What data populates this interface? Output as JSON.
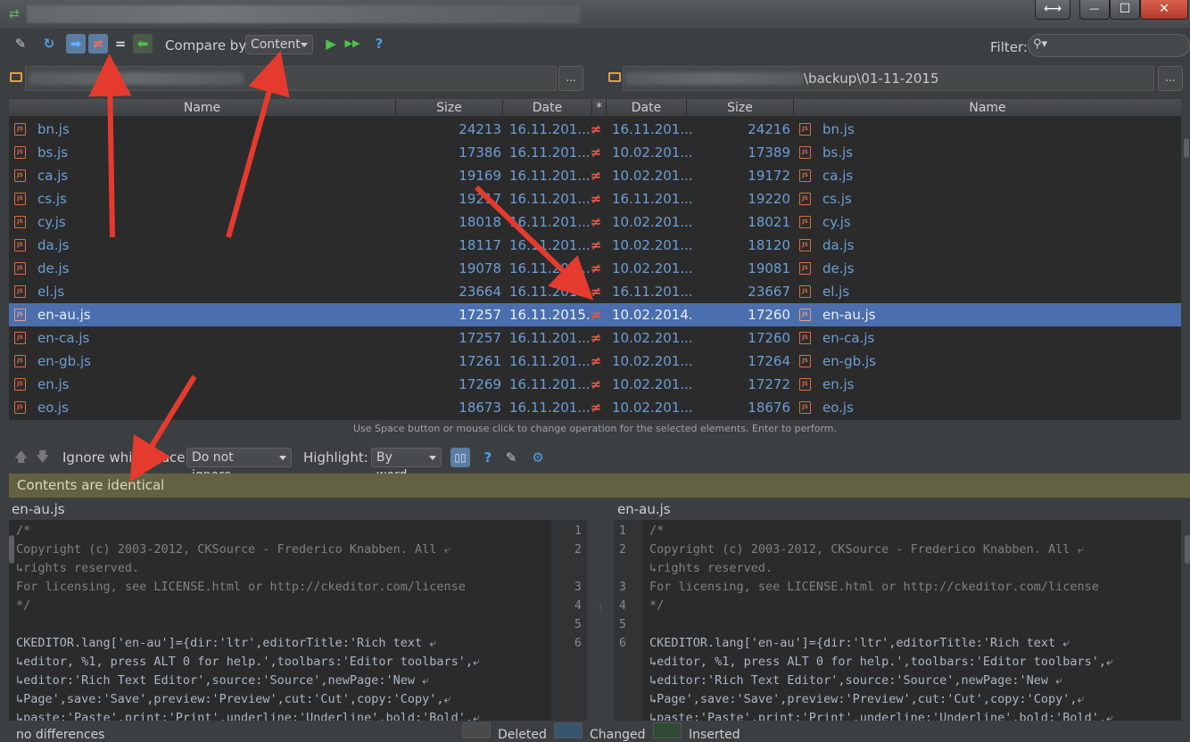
{
  "window": {
    "restore_glyph": "⟷",
    "minimize_glyph": "—",
    "maximize_glyph": "☐",
    "close_glyph": "✕"
  },
  "toolbar": {
    "compare_by_label": "Compare by:",
    "compare_by_value": "Content",
    "filter_label": "Filter:",
    "equal_glyph": "=",
    "neq_glyph": "≠",
    "help_glyph": "?"
  },
  "left_path": {
    "browse_label": "..."
  },
  "right_path": {
    "value": "\\backup\\01-11-2015",
    "browse_label": "..."
  },
  "table": {
    "headers": {
      "name": "Name",
      "size": "Size",
      "date": "Date",
      "star": "*",
      "rdate": "Date",
      "rsize": "Size",
      "rname": "Name"
    },
    "rows": [
      {
        "lname": "bn.js",
        "lsize": "24213",
        "ldate": "16.11.201...",
        "op": "≠",
        "rdate": "16.11.201...",
        "rsize": "24216",
        "rname": "bn.js"
      },
      {
        "lname": "bs.js",
        "lsize": "17386",
        "ldate": "16.11.201...",
        "op": "≠",
        "rdate": "10.02.201...",
        "rsize": "17389",
        "rname": "bs.js"
      },
      {
        "lname": "ca.js",
        "lsize": "19169",
        "ldate": "16.11.201...",
        "op": "≠",
        "rdate": "10.02.201...",
        "rsize": "19172",
        "rname": "ca.js"
      },
      {
        "lname": "cs.js",
        "lsize": "19217",
        "ldate": "16.11.201...",
        "op": "≠",
        "rdate": "16.11.201...",
        "rsize": "19220",
        "rname": "cs.js"
      },
      {
        "lname": "cy.js",
        "lsize": "18018",
        "ldate": "16.11.201...",
        "op": "≠",
        "rdate": "10.02.201...",
        "rsize": "18021",
        "rname": "cy.js"
      },
      {
        "lname": "da.js",
        "lsize": "18117",
        "ldate": "16.11.201...",
        "op": "≠",
        "rdate": "10.02.201...",
        "rsize": "18120",
        "rname": "da.js"
      },
      {
        "lname": "de.js",
        "lsize": "19078",
        "ldate": "16.11.201...",
        "op": "≠",
        "rdate": "10.02.201...",
        "rsize": "19081",
        "rname": "de.js"
      },
      {
        "lname": "el.js",
        "lsize": "23664",
        "ldate": "16.11.201...",
        "op": "≠",
        "rdate": "16.11.201...",
        "rsize": "23667",
        "rname": "el.js"
      },
      {
        "lname": "en-au.js",
        "lsize": "17257",
        "ldate": "16.11.2015...",
        "op": "≠",
        "rdate": "10.02.2014...",
        "rsize": "17260",
        "rname": "en-au.js",
        "selected": true
      },
      {
        "lname": "en-ca.js",
        "lsize": "17257",
        "ldate": "16.11.201...",
        "op": "≠",
        "rdate": "10.02.201...",
        "rsize": "17260",
        "rname": "en-ca.js"
      },
      {
        "lname": "en-gb.js",
        "lsize": "17261",
        "ldate": "16.11.201...",
        "op": "≠",
        "rdate": "10.02.201...",
        "rsize": "17264",
        "rname": "en-gb.js"
      },
      {
        "lname": "en.js",
        "lsize": "17269",
        "ldate": "16.11.201...",
        "op": "≠",
        "rdate": "10.02.201...",
        "rsize": "17272",
        "rname": "en.js"
      },
      {
        "lname": "eo.js",
        "lsize": "18673",
        "ldate": "16.11.201...",
        "op": "≠",
        "rdate": "10.02.201...",
        "rsize": "18676",
        "rname": "eo.js"
      }
    ]
  },
  "hint": "Use Space button or mouse click to change operation for the selected elements. Enter to perform.",
  "diff_toolbar": {
    "ignore_ws_label": "Ignore whitespace:",
    "ignore_ws_value": "Do not ignore",
    "highlight_label": "Highlight:",
    "highlight_value": "By word",
    "help_glyph": "?"
  },
  "banner": "Contents are identical",
  "left_editor": {
    "file": "en-au.js",
    "lines": [
      "/*",
      "Copyright (c) 2003-2012, CKSource - Frederico Knabben. All ⤶",
      "↳rights reserved.",
      "For licensing, see LICENSE.html or http://ckeditor.com/license",
      "*/",
      "",
      "CKEDITOR.lang['en-au']={dir:'ltr',editorTitle:'Rich text ⤶",
      "↳editor, %1, press ALT 0 for help.',toolbars:'Editor toolbars',⤶",
      "↳editor:'Rich Text Editor',source:'Source',newPage:'New ⤶",
      "↳Page',save:'Save',preview:'Preview',cut:'Cut',copy:'Copy',⤶",
      "↳paste:'Paste',print:'Print',underline:'Underline',bold:'Bold',⤶"
    ],
    "line_numbers": [
      "1",
      "2",
      "",
      "3",
      "4",
      "5",
      "6"
    ]
  },
  "right_editor": {
    "file": "en-au.js",
    "line_numbers": [
      "1",
      "2",
      "",
      "3",
      "4",
      "5",
      "6"
    ]
  },
  "status": {
    "left": "no differences",
    "deleted": "Deleted",
    "changed": "Changed",
    "inserted": "Inserted"
  },
  "colors": {
    "background": "#3c3f41",
    "table_bg": "#2b2b2b",
    "file_text": "#6c9ed6",
    "selected_row": "#4b6eaf",
    "neq": "#e0584a",
    "banner": "#626243",
    "annotation_arrow": "#e53a2e",
    "deleted": "#4a4a4a",
    "changed": "#385570",
    "inserted": "#2f4a35"
  }
}
